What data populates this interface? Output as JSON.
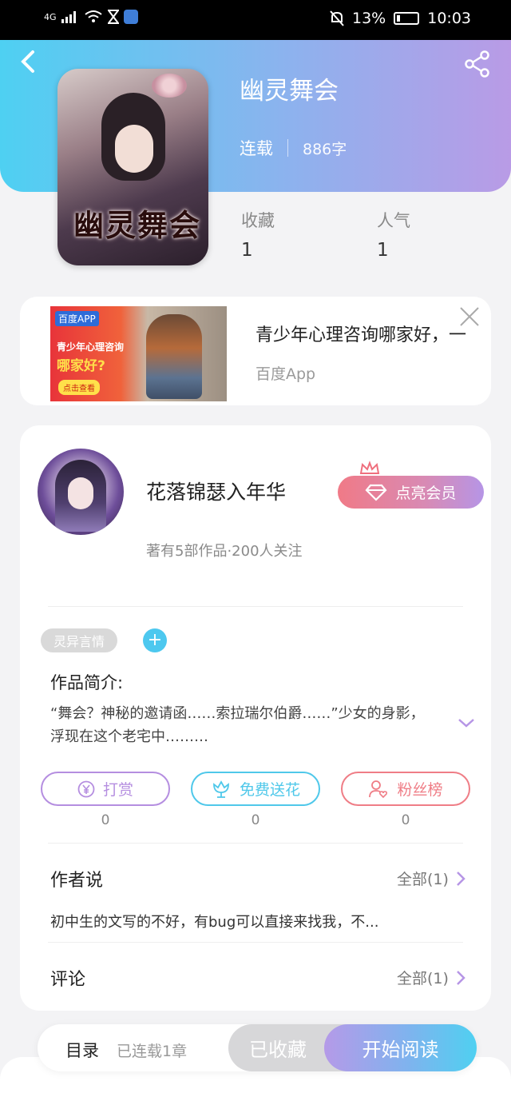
{
  "status_bar": {
    "network": "4G",
    "battery": "13%",
    "time": "10:03"
  },
  "book": {
    "title": "幽灵舞会",
    "status": "连载",
    "word_count": "886字",
    "cover_title": "幽灵舞会"
  },
  "stats": {
    "favorites_label": "收藏",
    "favorites_value": "1",
    "popularity_label": "人气",
    "popularity_value": "1"
  },
  "ad": {
    "image_logo": "百度APP",
    "image_line1": "青少年心理咨询",
    "image_line2": "哪家好?",
    "image_button": "点击查看",
    "title": "青少年心理咨询哪家好，一",
    "source": "百度App"
  },
  "author": {
    "name": "花落锦瑟入年华",
    "info": "著有5部作品·200人关注",
    "vip_label": "点亮会员"
  },
  "tags": [
    "灵异言情"
  ],
  "intro": {
    "heading": "作品简介:",
    "text": "“舞会？神秘的邀请函……索拉瑞尔伯爵……”少女的身影，浮现在这个老宅中………"
  },
  "actions": [
    {
      "label": "打赏",
      "count": "0",
      "color": "#b58ee0"
    },
    {
      "label": "免费送花",
      "count": "0",
      "color": "#4fc8ea"
    },
    {
      "label": "粉丝榜",
      "count": "0",
      "color": "#ef7d86"
    }
  ],
  "author_say": {
    "title": "作者说",
    "all_label": "全部(1)",
    "text": "初中生的文写的不好，有bug可以直接来找我，不..."
  },
  "comments": {
    "title": "评论",
    "all_label": "全部(1)"
  },
  "bottom": {
    "toc_label": "目录",
    "toc_sub": "已连载1章",
    "favorited_label": "已收藏",
    "read_label": "开始阅读"
  },
  "colors": {
    "header_start": "#4ed0f2",
    "header_end": "#b99be6",
    "accent_blue": "#4dc8ef",
    "accent_purple": "#b695e6"
  }
}
